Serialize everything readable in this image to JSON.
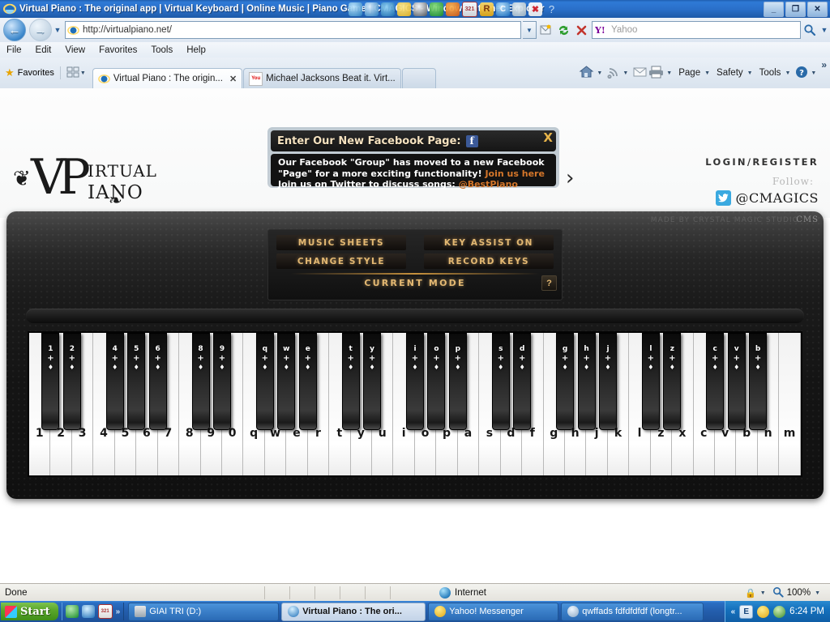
{
  "window": {
    "title": "Virtual Piano : The original app | Virtual Keyboard | Online Music | Piano Game | CMAGICS - Windows Internet Explorer",
    "minimize": "_",
    "restore": "❐",
    "close": "✕"
  },
  "navbar": {
    "back_icon": "←",
    "forward_icon": "→",
    "history_caret": "▼",
    "url": "http://virtualpiano.net/",
    "address_caret": "▼",
    "search_placeholder": "Yahoo",
    "search_go": "⚲",
    "search_caret": "▼"
  },
  "menu": {
    "items": [
      "File",
      "Edit",
      "View",
      "Favorites",
      "Tools",
      "Help"
    ]
  },
  "favorites": {
    "label": "Favorites"
  },
  "tabs": [
    {
      "title": "Virtual Piano : The origin...",
      "close": "✕",
      "active": true
    },
    {
      "title": "Michael Jacksons Beat it. Virt...",
      "active": false
    }
  ],
  "command_bar": {
    "items": [
      "Page",
      "Safety",
      "Tools"
    ],
    "caret": "▼",
    "overflow": "»"
  },
  "site": {
    "logo": {
      "monogram": "VP",
      "line1": "IRTUAL",
      "line2": "IANO"
    },
    "banner": {
      "title": "Enter Our New Facebook Page:",
      "fb_icon_letter": "f",
      "close": "X",
      "line1": "Our Facebook \"Group\" has moved to a new Facebook",
      "line2_text": "\"Page\" for a more exciting functionality!",
      "line2_link": "Join us here",
      "line3_text": "Join us on Twitter to discuss songs:",
      "line3_link": "@BestPiano",
      "next_arrow": "›"
    },
    "login_register": "LOGIN/REGISTER",
    "follow_label": "Follow:",
    "twitter_handle": "@CMAGICS",
    "twitter_icon": "ᵥ"
  },
  "piano": {
    "made_by": "MADE BY CRYSTAL MAGIC STUDIO",
    "cms_logo": "CMS",
    "buttons": [
      "MUSIC SHEETS",
      "KEY ASSIST ON",
      "CHANGE STYLE",
      "RECORD KEYS"
    ],
    "current_mode": "CURRENT MODE",
    "help": "?",
    "white_keys": [
      "1",
      "2",
      "3",
      "4",
      "5",
      "6",
      "7",
      "8",
      "9",
      "0",
      "q",
      "w",
      "e",
      "r",
      "t",
      "y",
      "u",
      "i",
      "o",
      "p",
      "a",
      "s",
      "d",
      "f",
      "g",
      "h",
      "j",
      "k",
      "l",
      "z",
      "x",
      "c",
      "v",
      "b",
      "n",
      "m"
    ],
    "black_keys": [
      {
        "label": "1",
        "after_white": 0
      },
      {
        "label": "2",
        "after_white": 1
      },
      {
        "label": "4",
        "after_white": 3
      },
      {
        "label": "5",
        "after_white": 4
      },
      {
        "label": "6",
        "after_white": 5
      },
      {
        "label": "8",
        "after_white": 7
      },
      {
        "label": "9",
        "after_white": 8
      },
      {
        "label": "q",
        "after_white": 10
      },
      {
        "label": "w",
        "after_white": 11
      },
      {
        "label": "e",
        "after_white": 12
      },
      {
        "label": "t",
        "after_white": 14
      },
      {
        "label": "y",
        "after_white": 15
      },
      {
        "label": "i",
        "after_white": 17
      },
      {
        "label": "o",
        "after_white": 18
      },
      {
        "label": "p",
        "after_white": 19
      },
      {
        "label": "s",
        "after_white": 21
      },
      {
        "label": "d",
        "after_white": 22
      },
      {
        "label": "g",
        "after_white": 24
      },
      {
        "label": "h",
        "after_white": 25
      },
      {
        "label": "j",
        "after_white": 26
      },
      {
        "label": "l",
        "after_white": 28
      },
      {
        "label": "z",
        "after_white": 29
      },
      {
        "label": "c",
        "after_white": 31
      },
      {
        "label": "v",
        "after_white": 32
      },
      {
        "label": "b",
        "after_white": 33
      }
    ],
    "black_key_modifier": "+",
    "black_key_arrow": "♦"
  },
  "statusbar": {
    "status": "Done",
    "zone": "Internet",
    "zoom": "100%",
    "zoom_caret": "▼",
    "lock_caret": "▼"
  },
  "taskbar": {
    "start": "Start",
    "quicklaunch_overflow": "»",
    "buttons": [
      {
        "label": "GIAI TRI (D:)",
        "active": false
      },
      {
        "label": "Virtual Piano : The ori...",
        "active": true
      },
      {
        "label": "Yahoo! Messenger",
        "active": false
      },
      {
        "label": "qwffads fdfdfdfdf (longtr...",
        "active": false
      }
    ],
    "tray_chevron": "«",
    "tray_ie": "E",
    "clock": "6:24 PM"
  },
  "colors": {
    "accent_gold": "#e3b872",
    "link_orange": "#d4762a",
    "facebook_blue": "#3b5998",
    "twitter_blue": "#3aa9e0",
    "titlebar_blue": "#2a6fc9"
  }
}
